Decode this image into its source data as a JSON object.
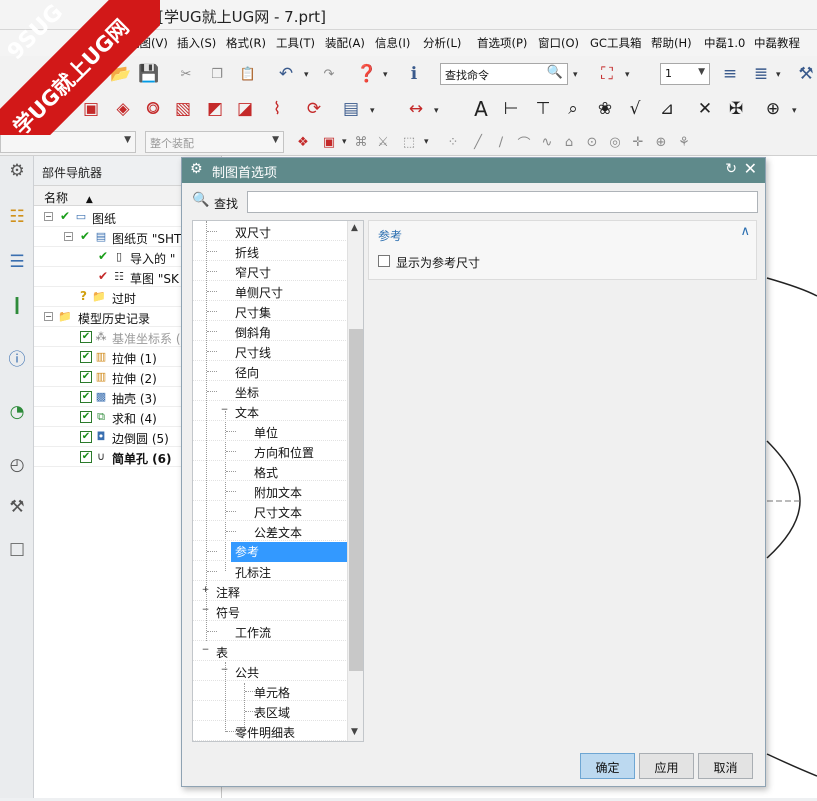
{
  "window": {
    "title": "- [学UG就上UG网 - 7.prt]"
  },
  "watermark": {
    "line1": "9SUG",
    "line2": "学UG就上UG网"
  },
  "menu": [
    "视图(V)",
    "插入(S)",
    "格式(R)",
    "工具(T)",
    "装配(A)",
    "信息(I)",
    "分析(L)",
    "首选项(P)",
    "窗口(O)",
    "GC工具箱",
    "帮助(H)",
    "中磊1.0",
    "中磊教程"
  ],
  "toolbar": {
    "find_command": "查找命令",
    "layer_value": "1",
    "selection_filter": "",
    "assembly_scope": "整个装配"
  },
  "navigator": {
    "title": "部件导航器",
    "column_name": "名称",
    "nodes": [
      {
        "label": "图纸",
        "depth": 0
      },
      {
        "label": "图纸页 \"SHT",
        "depth": 1
      },
      {
        "label": "导入的 \"",
        "depth": 2
      },
      {
        "label": "草图 \"SK",
        "depth": 2
      },
      {
        "label": "过时",
        "depth": 1
      },
      {
        "label": "模型历史记录",
        "depth": 0
      },
      {
        "label": "基准坐标系 (",
        "depth": 1
      },
      {
        "label": "拉伸 (1)",
        "depth": 1
      },
      {
        "label": "拉伸 (2)",
        "depth": 1
      },
      {
        "label": "抽壳 (3)",
        "depth": 1
      },
      {
        "label": "求和 (4)",
        "depth": 1
      },
      {
        "label": "边倒圆 (5)",
        "depth": 1
      },
      {
        "label": "简单孔 (6)",
        "depth": 1
      }
    ]
  },
  "dialog": {
    "title": "制图首选项",
    "search_label": "查找",
    "search_value": "",
    "tree": [
      {
        "label": "双尺寸",
        "level": 1
      },
      {
        "label": "折线",
        "level": 1
      },
      {
        "label": "窄尺寸",
        "level": 1
      },
      {
        "label": "单侧尺寸",
        "level": 1
      },
      {
        "label": "尺寸集",
        "level": 1
      },
      {
        "label": "倒斜角",
        "level": 1
      },
      {
        "label": "尺寸线",
        "level": 1
      },
      {
        "label": "径向",
        "level": 1
      },
      {
        "label": "坐标",
        "level": 1
      },
      {
        "label": "文本",
        "level": 1
      },
      {
        "label": "单位",
        "level": 2
      },
      {
        "label": "方向和位置",
        "level": 2
      },
      {
        "label": "格式",
        "level": 2
      },
      {
        "label": "附加文本",
        "level": 2
      },
      {
        "label": "尺寸文本",
        "level": 2
      },
      {
        "label": "公差文本",
        "level": 2
      },
      {
        "label": "参考",
        "level": 1,
        "selected": true
      },
      {
        "label": "孔标注",
        "level": 1
      },
      {
        "label": "注释",
        "level": 0
      },
      {
        "label": "符号",
        "level": 0
      },
      {
        "label": "工作流",
        "level": 1
      },
      {
        "label": "表",
        "level": 0
      },
      {
        "label": "公共",
        "level": 1
      },
      {
        "label": "单元格",
        "level": 2
      },
      {
        "label": "表区域",
        "level": 2
      },
      {
        "label": "零件明细表",
        "level": 1
      }
    ],
    "panel": {
      "title": "参考",
      "checkbox_label": "显示为参考尺寸",
      "checked": false
    },
    "buttons": {
      "ok": "确定",
      "apply": "应用",
      "cancel": "取消"
    }
  }
}
